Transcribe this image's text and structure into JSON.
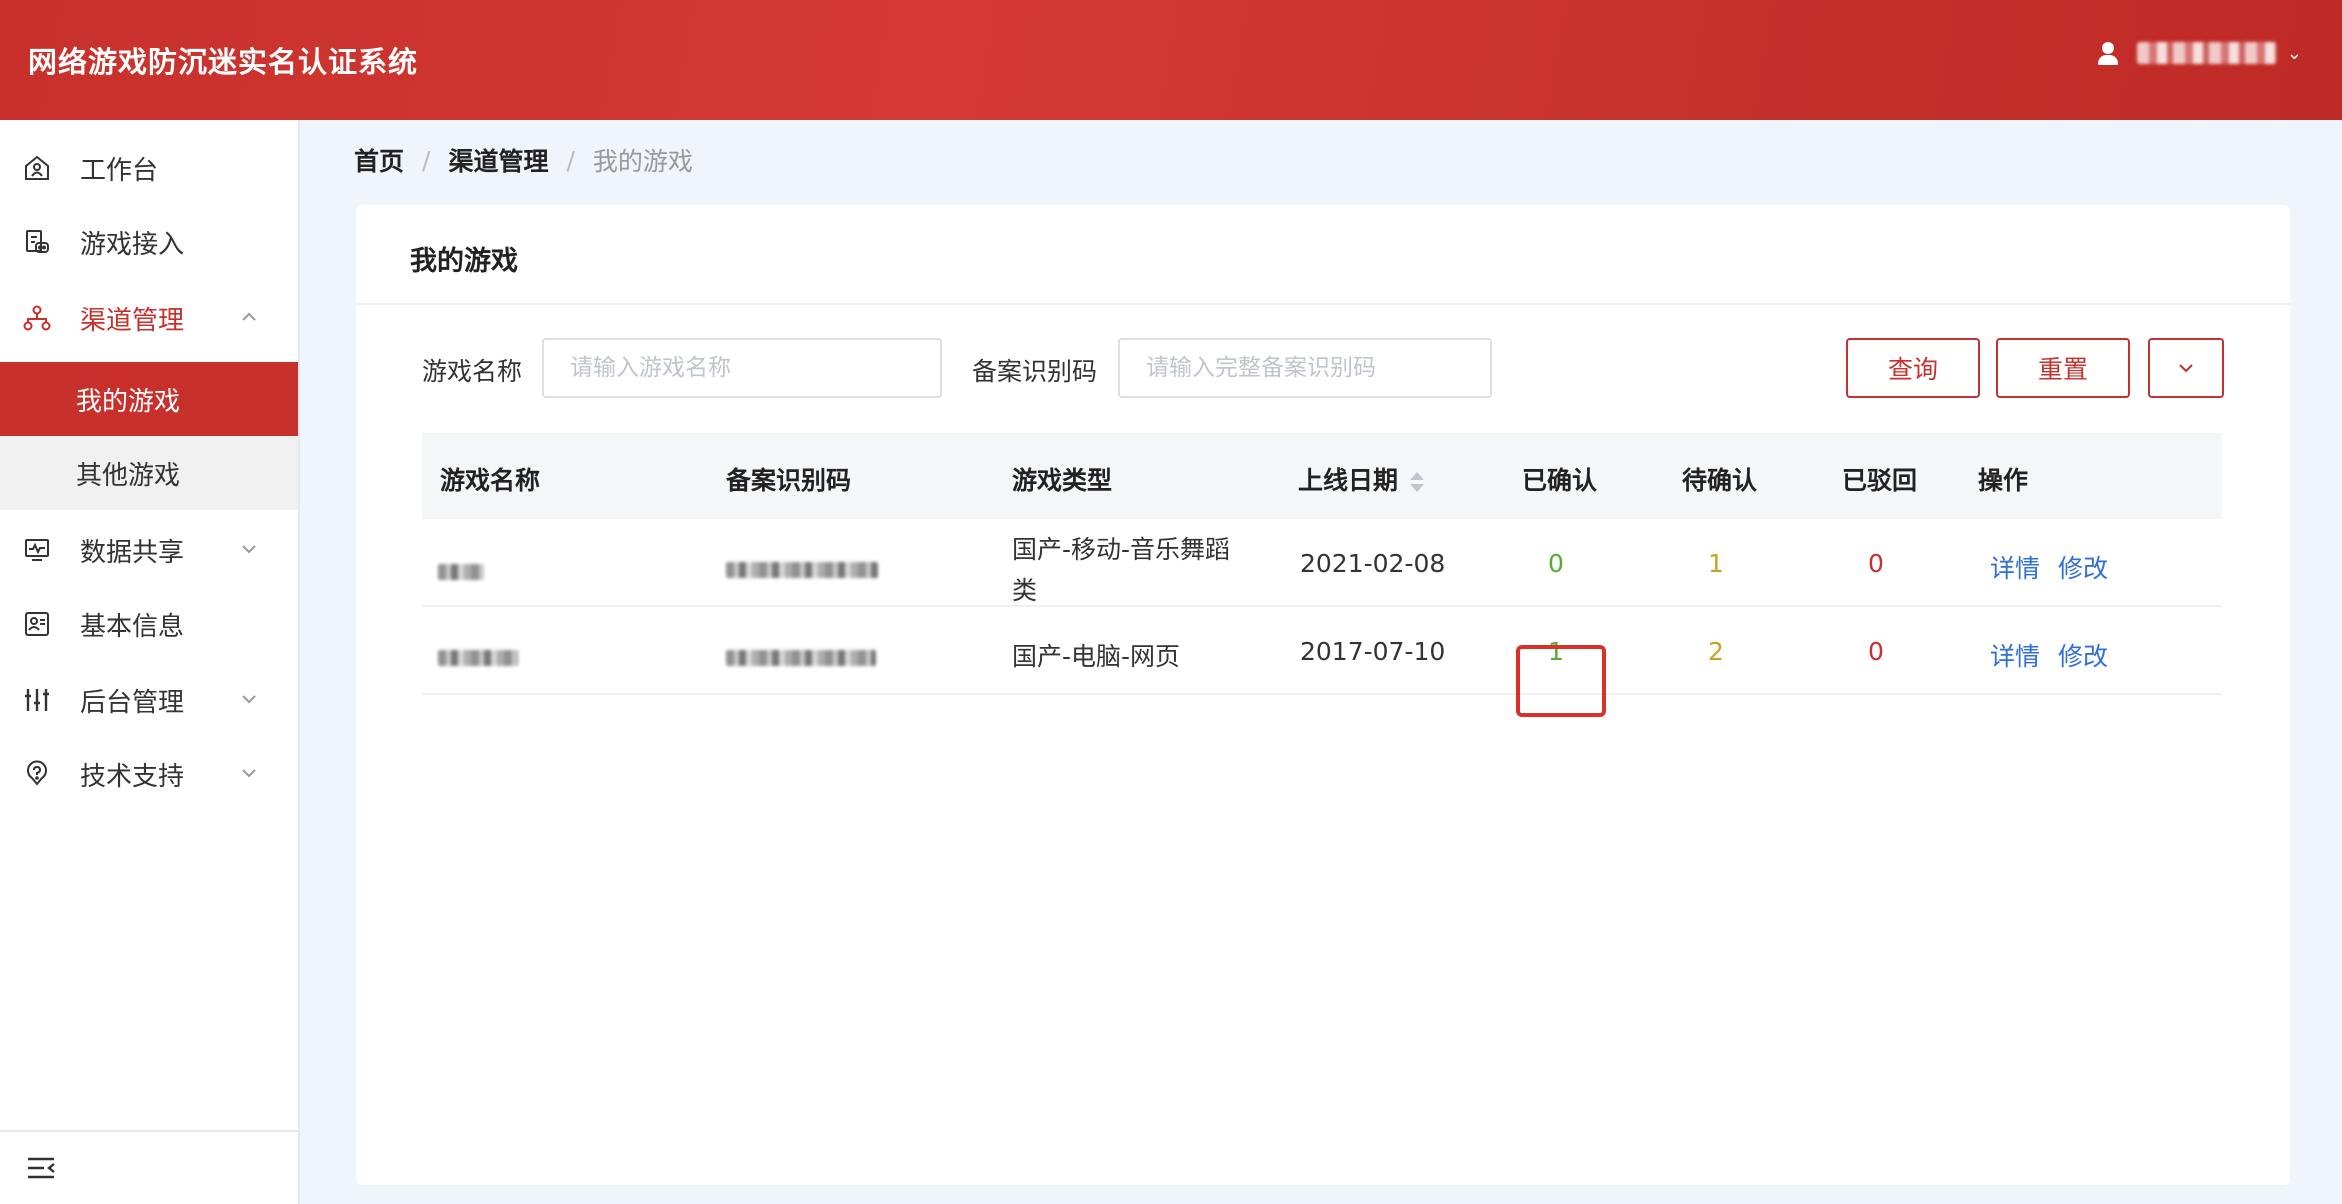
{
  "header": {
    "title": "网络游戏防沉迷实名认证系统",
    "user_name": "",
    "caret": "⌄"
  },
  "sidebar": {
    "items": [
      {
        "label": "工作台",
        "icon": "home-icon"
      },
      {
        "label": "游戏接入",
        "icon": "game-access-icon"
      },
      {
        "label": "渠道管理",
        "icon": "channel-icon",
        "open": true
      },
      {
        "label": "数据共享",
        "icon": "data-share-icon"
      },
      {
        "label": "基本信息",
        "icon": "info-card-icon"
      },
      {
        "label": "后台管理",
        "icon": "sliders-icon"
      },
      {
        "label": "技术支持",
        "icon": "help-icon"
      }
    ],
    "sub_items": [
      {
        "label": "我的游戏",
        "active": true
      },
      {
        "label": "其他游戏",
        "active": false
      }
    ],
    "collapse_icon": "menu-collapse-icon"
  },
  "breadcrumb": {
    "home": "首页",
    "channel": "渠道管理",
    "current": "我的游戏",
    "sep": "/"
  },
  "card": {
    "title": "我的游戏"
  },
  "filters": {
    "game_name_label": "游戏名称",
    "game_name_placeholder": "请输入游戏名称",
    "record_code_label": "备案识别码",
    "record_code_placeholder": "请输入完整备案识别码",
    "query_button": "查询",
    "reset_button": "重置"
  },
  "table": {
    "columns": [
      "游戏名称",
      "备案识别码",
      "游戏类型",
      "上线日期",
      "已确认",
      "待确认",
      "已驳回",
      "操作"
    ],
    "rows": [
      {
        "type": "国产-移动-音乐舞蹈类",
        "type_line1": "国产-移动-音乐舞蹈",
        "type_line2": "类",
        "date": "2021-02-08",
        "confirmed": "0",
        "pending": "1",
        "rejected": "0",
        "detail": "详情",
        "edit": "修改"
      },
      {
        "type": "国产-电脑-网页",
        "date": "2017-07-10",
        "confirmed": "1",
        "pending": "2",
        "rejected": "0",
        "detail": "详情",
        "edit": "修改"
      }
    ]
  },
  "colors": {
    "brand": "#c8302c",
    "link": "#2f6fd6",
    "confirmed": "#5aa832",
    "pending": "#c9a320",
    "rejected": "#c8302c"
  }
}
